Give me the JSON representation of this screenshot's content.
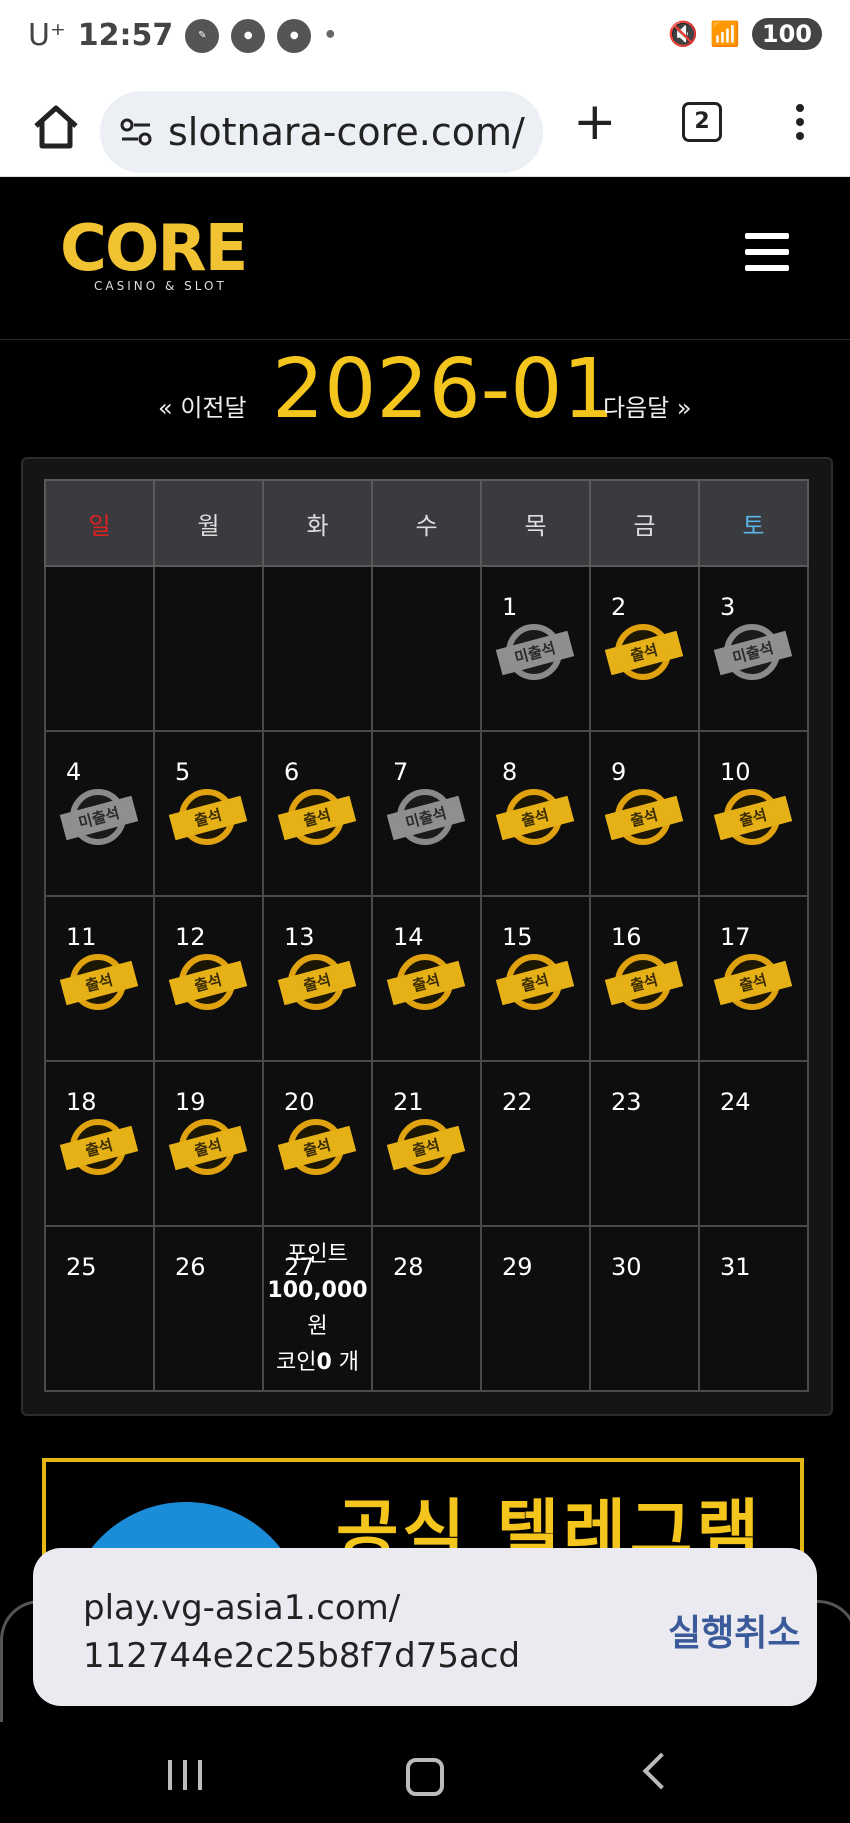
{
  "status_bar": {
    "carrier": "U⁺",
    "time": "12:57",
    "battery": "100"
  },
  "browser": {
    "url": "slotnara-core.com/",
    "tab_count": "2"
  },
  "site": {
    "logo_text": "CORE",
    "logo_subtext": "CASINO & SLOT"
  },
  "calendar": {
    "prev_label": "« 이전달",
    "month": "2026-01",
    "next_label": "다음달 »",
    "weekdays": [
      "일",
      "월",
      "화",
      "수",
      "목",
      "금",
      "토"
    ],
    "weekday_colors": [
      "#e02020",
      "#dddddd",
      "#dddddd",
      "#dddddd",
      "#dddddd",
      "#dddddd",
      "#5ab4e6"
    ],
    "weeks": [
      [
        {
          "day": "",
          "stamp": ""
        },
        {
          "day": "",
          "stamp": ""
        },
        {
          "day": "",
          "stamp": ""
        },
        {
          "day": "",
          "stamp": ""
        },
        {
          "day": "1",
          "stamp": "미출석"
        },
        {
          "day": "2",
          "stamp": "출석"
        },
        {
          "day": "3",
          "stamp": "미출석"
        }
      ],
      [
        {
          "day": "4",
          "stamp": "미출석"
        },
        {
          "day": "5",
          "stamp": "출석"
        },
        {
          "day": "6",
          "stamp": "출석"
        },
        {
          "day": "7",
          "stamp": "미출석"
        },
        {
          "day": "8",
          "stamp": "출석"
        },
        {
          "day": "9",
          "stamp": "출석"
        },
        {
          "day": "10",
          "stamp": "출석"
        }
      ],
      [
        {
          "day": "11",
          "stamp": "출석"
        },
        {
          "day": "12",
          "stamp": "출석"
        },
        {
          "day": "13",
          "stamp": "출석"
        },
        {
          "day": "14",
          "stamp": "출석"
        },
        {
          "day": "15",
          "stamp": "출석"
        },
        {
          "day": "16",
          "stamp": "출석"
        },
        {
          "day": "17",
          "stamp": "출석"
        }
      ],
      [
        {
          "day": "18",
          "stamp": "출석"
        },
        {
          "day": "19",
          "stamp": "출석"
        },
        {
          "day": "20",
          "stamp": "출석"
        },
        {
          "day": "21",
          "stamp": "출석"
        },
        {
          "day": "22",
          "stamp": ""
        },
        {
          "day": "23",
          "stamp": ""
        },
        {
          "day": "24",
          "stamp": ""
        }
      ],
      [
        {
          "day": "25",
          "stamp": ""
        },
        {
          "day": "26",
          "stamp": ""
        },
        {
          "day": "27",
          "stamp": ""
        },
        {
          "day": "28",
          "stamp": ""
        },
        {
          "day": "29",
          "stamp": ""
        },
        {
          "day": "30",
          "stamp": ""
        },
        {
          "day": "31",
          "stamp": ""
        }
      ]
    ],
    "points_popup": {
      "label": "포인트",
      "amount": "100,000",
      "unit": "원",
      "coin_label": "코인",
      "coin_value": "0",
      "coin_unit": "개"
    }
  },
  "banner": {
    "text": "공식 텔레그램"
  },
  "toast": {
    "line1": "play.vg-asia1.com/",
    "line2": "112744e2c25b8f7d75acd",
    "action": "실행취소"
  }
}
